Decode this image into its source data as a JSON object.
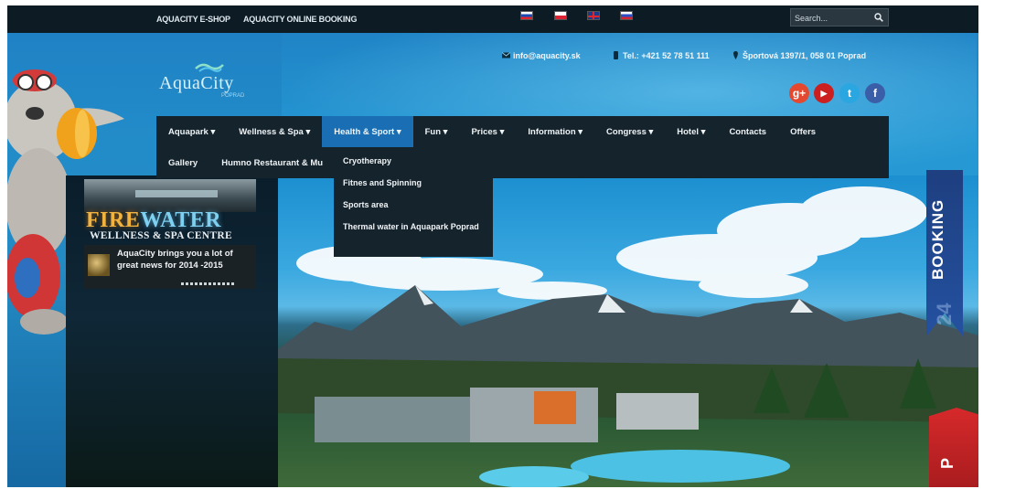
{
  "topbar": {
    "links": [
      "AQUACITY E-SHOP",
      "AQUACITY ONLINE BOOKING"
    ],
    "search_placeholder": "Search..."
  },
  "contacts": {
    "email": "info@aquacity.sk",
    "phone": "Tel.: +421 52 78 51 111",
    "address": "Športová 1397/1, 058 01 Poprad"
  },
  "logo": {
    "name": "AquaCity",
    "sub": "POPRAD"
  },
  "social": [
    {
      "icon": "google-plus-icon",
      "label": "g+",
      "color": "#e4492f"
    },
    {
      "icon": "youtube-icon",
      "label": "▶",
      "color": "#cc2020"
    },
    {
      "icon": "twitter-icon",
      "label": "t",
      "color": "#2aa7e0"
    },
    {
      "icon": "facebook-icon",
      "label": "f",
      "color": "#3b5ea8"
    }
  ],
  "nav": {
    "row1": [
      "Aquapark ▾",
      "Wellness & Spa ▾",
      "Health & Sport ▾",
      "Fun ▾",
      "Prices ▾",
      "Information ▾",
      "Congress ▾",
      "Hotel ▾",
      "Contacts",
      "Offers"
    ],
    "row2": [
      "Gallery",
      "Humno Restaurant & Mu"
    ],
    "active_index": 2
  },
  "dropdown": [
    "Cryotherapy",
    "Fitnes and Spinning",
    "Sports area",
    "Thermal water in Aquapark Poprad"
  ],
  "promo": {
    "title_fire": "FIRE",
    "title_water": "WATER",
    "subtitle": "WELLNESS & SPA CENTRE",
    "news": "AquaCity brings you a lot of great news for 2014 -2015"
  },
  "booking": {
    "label": "BOOKING",
    "badge": "24"
  },
  "side_tab": {
    "letter": "P"
  }
}
